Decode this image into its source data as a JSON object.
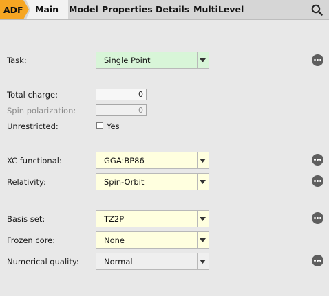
{
  "tabs": {
    "adf": "ADF",
    "main": "Main",
    "model": "Model",
    "properties": "Properties",
    "details": "Details",
    "multilevel": "MultiLevel"
  },
  "form": {
    "task": {
      "label": "Task:",
      "value": "Single Point",
      "bg": "#d8f5d8"
    },
    "total_charge": {
      "label": "Total charge:",
      "value": "0"
    },
    "spin_polarization": {
      "label": "Spin polarization:",
      "value": "0",
      "disabled": true
    },
    "unrestricted": {
      "label": "Unrestricted:",
      "checkbox_label": "Yes",
      "checked": false
    },
    "xc_functional": {
      "label": "XC functional:",
      "value": "GGA:BP86",
      "bg": "#ffffdf"
    },
    "relativity": {
      "label": "Relativity:",
      "value": "Spin-Orbit",
      "bg": "#ffffdf"
    },
    "basis_set": {
      "label": "Basis set:",
      "value": "TZ2P",
      "bg": "#ffffdf"
    },
    "frozen_core": {
      "label": "Frozen core:",
      "value": "None",
      "bg": "#ffffdf"
    },
    "numerical_quality": {
      "label": "Numerical quality:",
      "value": "Normal",
      "bg": "#efefef"
    }
  },
  "colors": {
    "accent": "#f6a623",
    "tab_bar": "#d6d6d6",
    "panel": "#e8e8e8",
    "more_button": "#5e5e5e"
  },
  "icons": {
    "search": "search-icon",
    "more": "more-options-icon",
    "dropdown": "chevron-down-icon"
  }
}
